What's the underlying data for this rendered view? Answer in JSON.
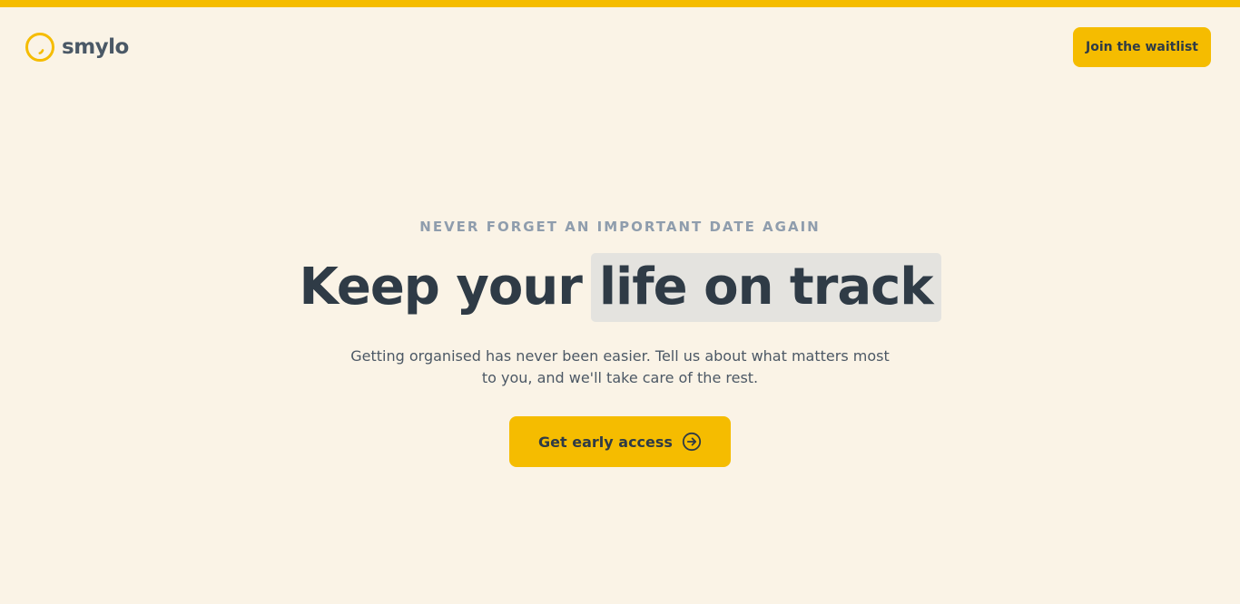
{
  "brand": {
    "name": "smylo",
    "logo_icon": "smile-circle-icon",
    "accent_color": "#f5bc00",
    "background_color": "#faf3e6"
  },
  "header": {
    "waitlist_label": "Join the waitlist"
  },
  "hero": {
    "eyebrow": "NEVER FORGET AN IMPORTANT DATE AGAIN",
    "headline_plain": "Keep your",
    "headline_highlight": "life on track",
    "subtitle": "Getting organised has never been easier. Tell us about what matters most to you, and we'll take care of the rest.",
    "cta_label": "Get early access",
    "cta_icon": "arrow-right-circle-icon"
  }
}
